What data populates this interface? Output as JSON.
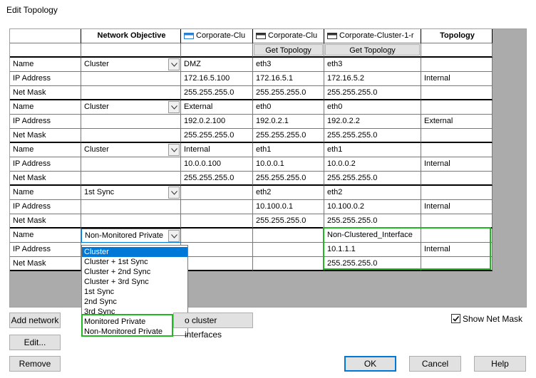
{
  "window": {
    "title": "Edit Topology"
  },
  "columns": {
    "network_objective": "Network Objective",
    "member1": "Corporate-Clu",
    "member2": "Corporate-Clu",
    "member3": "Corporate-Cluster-1-r",
    "topology": "Topology",
    "get_topology": "Get Topology"
  },
  "row_labels": {
    "name": "Name",
    "ip": "IP Address",
    "mask": "Net Mask"
  },
  "interfaces": [
    {
      "objective": "Cluster",
      "cluster_name": "DMZ",
      "cluster_ip": "172.16.5.100",
      "cluster_mask": "255.255.255.0",
      "m1_name": "eth3",
      "m1_ip": "172.16.5.1",
      "m1_mask": "255.255.255.0",
      "m2_name": "eth3",
      "m2_ip": "172.16.5.2",
      "m2_mask": "255.255.255.0",
      "topology": "Internal"
    },
    {
      "objective": "Cluster",
      "cluster_name": "External",
      "cluster_ip": "192.0.2.100",
      "cluster_mask": "255.255.255.0",
      "m1_name": "eth0",
      "m1_ip": "192.0.2.1",
      "m1_mask": "255.255.255.0",
      "m2_name": "eth0",
      "m2_ip": "192.0.2.2",
      "m2_mask": "255.255.255.0",
      "topology": "External"
    },
    {
      "objective": "Cluster",
      "cluster_name": "Internal",
      "cluster_ip": "10.0.0.100",
      "cluster_mask": "255.255.255.0",
      "m1_name": "eth1",
      "m1_ip": "10.0.0.1",
      "m1_mask": "255.255.255.0",
      "m2_name": "eth1",
      "m2_ip": "10.0.0.2",
      "m2_mask": "255.255.255.0",
      "topology": "Internal"
    },
    {
      "objective": "1st Sync",
      "cluster_name": "",
      "cluster_ip": "",
      "cluster_mask": "",
      "m1_name": "eth2",
      "m1_ip": "10.100.0.1",
      "m1_mask": "255.255.255.0",
      "m2_name": "eth2",
      "m2_ip": "10.100.0.2",
      "m2_mask": "255.255.255.0",
      "topology": "Internal"
    },
    {
      "objective": "Non-Monitored Private",
      "cluster_name": "",
      "cluster_ip": "",
      "cluster_mask": "",
      "m1_name": "",
      "m1_ip": "",
      "m1_mask": "",
      "m2_name": "Non-Clustered_Interface",
      "m2_ip": "10.1.1.1",
      "m2_mask": "255.255.255.0",
      "topology": "Internal"
    }
  ],
  "dropdown_options": [
    "Cluster",
    "Cluster + 1st Sync",
    "Cluster + 2nd Sync",
    "Cluster + 3rd Sync",
    "1st Sync",
    "2nd Sync",
    "3rd Sync",
    "Monitored Private",
    "Non-Monitored Private"
  ],
  "dropdown_selected": "Cluster",
  "buttons": {
    "add_network": "Add network",
    "cluster_interfaces": "o cluster interfaces",
    "edit": "Edit...",
    "remove": "Remove",
    "ok": "OK",
    "cancel": "Cancel",
    "help": "Help"
  },
  "show_net_mask": {
    "label": "Show Net Mask",
    "checked": true
  }
}
